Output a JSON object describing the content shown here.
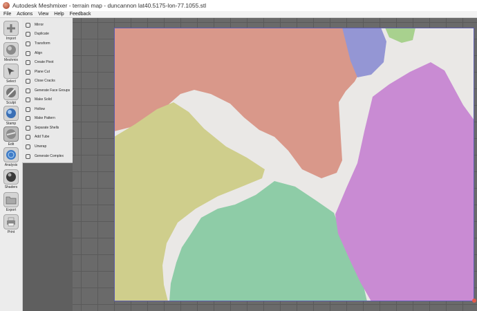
{
  "window": {
    "title": "Autodesk Meshmixer - terrain map - duncannon lat40.5175-lon-77.1055.stl"
  },
  "menu": [
    "File",
    "Actions",
    "View",
    "Help",
    "Feedback"
  ],
  "tools": [
    {
      "label": "Import",
      "icon": "plus-icon"
    },
    {
      "label": "Meshmix",
      "icon": "meshmix-sphere-icon"
    },
    {
      "label": "Select",
      "icon": "select-cursor-icon"
    },
    {
      "label": "Sculpt",
      "icon": "sculpt-brush-icon"
    },
    {
      "label": "Stamp",
      "icon": "stamp-icon"
    },
    {
      "label": "Edit",
      "icon": "edit-sphere-icon"
    },
    {
      "label": "Analysis",
      "icon": "analysis-sphere-icon"
    },
    {
      "label": "Shaders",
      "icon": "shaders-sphere-icon"
    },
    {
      "label": "Export",
      "icon": "export-folder-icon"
    },
    {
      "label": "Print",
      "icon": "print-icon"
    }
  ],
  "active_tool": "Edit",
  "edit_menu": [
    "Mirror",
    "Duplicate",
    "Transform",
    "Align",
    "Create Pivot",
    "Plane Cut",
    "Close Cracks",
    "Generate Face Groups",
    "Make Solid",
    "Hollow",
    "Make Pattern",
    "Separate Shells",
    "Add Tube",
    "Unwrap",
    "Generate Complex"
  ],
  "colors": {
    "salmon_region": "#d9988a",
    "olive_region": "#cfce8c",
    "green_region": "#8ecca7",
    "purple_region": "#c98bd3",
    "blue_region": "#9496d4",
    "lightgreen_region": "#a8d18e",
    "river": "#eae8e6",
    "mesh_edge": "#5c5cb0"
  }
}
